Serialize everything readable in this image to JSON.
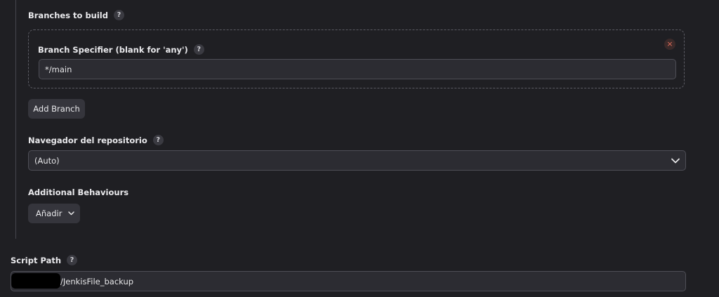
{
  "branches": {
    "title": "Branches to build",
    "help_icon": "?",
    "specifier_label": "Branch Specifier (blank for 'any')",
    "specifier_value": "*/main",
    "close_icon": "×",
    "add_branch_label": "Add Branch"
  },
  "repo_browser": {
    "title": "Navegador del repositorio",
    "selected": "(Auto)"
  },
  "behaviours": {
    "title": "Additional Behaviours",
    "add_label": "Añadir"
  },
  "script_path": {
    "title": "Script Path",
    "value": "/JenkisFile_backup"
  },
  "colors": {
    "background": "#1f1f23",
    "input_background": "#2c2c32",
    "button_background": "#35353c",
    "close_icon": "#e06c5a"
  }
}
